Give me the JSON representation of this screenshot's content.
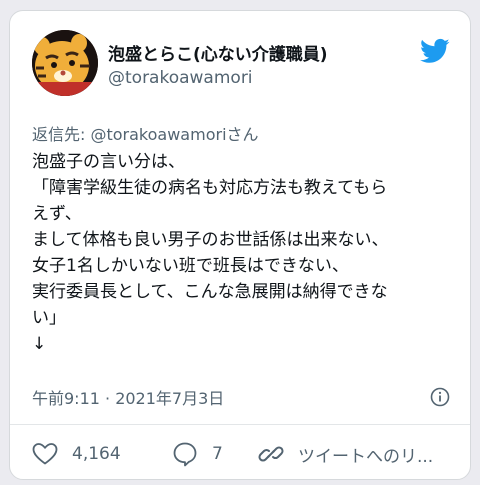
{
  "tweet": {
    "author": {
      "display_name": "泡盛とらこ(心ない介護職員)",
      "handle": "@torakoawamori",
      "avatar_icon": "tiger-avatar"
    },
    "brand_icon": "twitter-bird-icon",
    "brand_color": "#1d9bf0",
    "reply_to": {
      "prefix": "返信先: ",
      "handle": "@torakoawamori",
      "suffix": "さん",
      "link_color": "#1d9bf0"
    },
    "body_lines": [
      "泡盛子の言い分は、",
      "「障害学級生徒の病名も対応方法も教えてもら",
      "えず、",
      "まして体格も良い男子のお世話係は出来ない、",
      "女子1名しかいない班で班長はできない、",
      "実行委員長として、こんな急展開は納得できな",
      "い」",
      "↓"
    ],
    "timestamp": "午前9:11 · 2021年7月3日",
    "actions": {
      "likes": {
        "icon": "heart-icon",
        "count": "4,164"
      },
      "replies": {
        "icon": "reply-bubble-icon",
        "count": "7"
      },
      "share": {
        "icon": "link-icon",
        "label": "ツイートへのリ..."
      }
    }
  }
}
